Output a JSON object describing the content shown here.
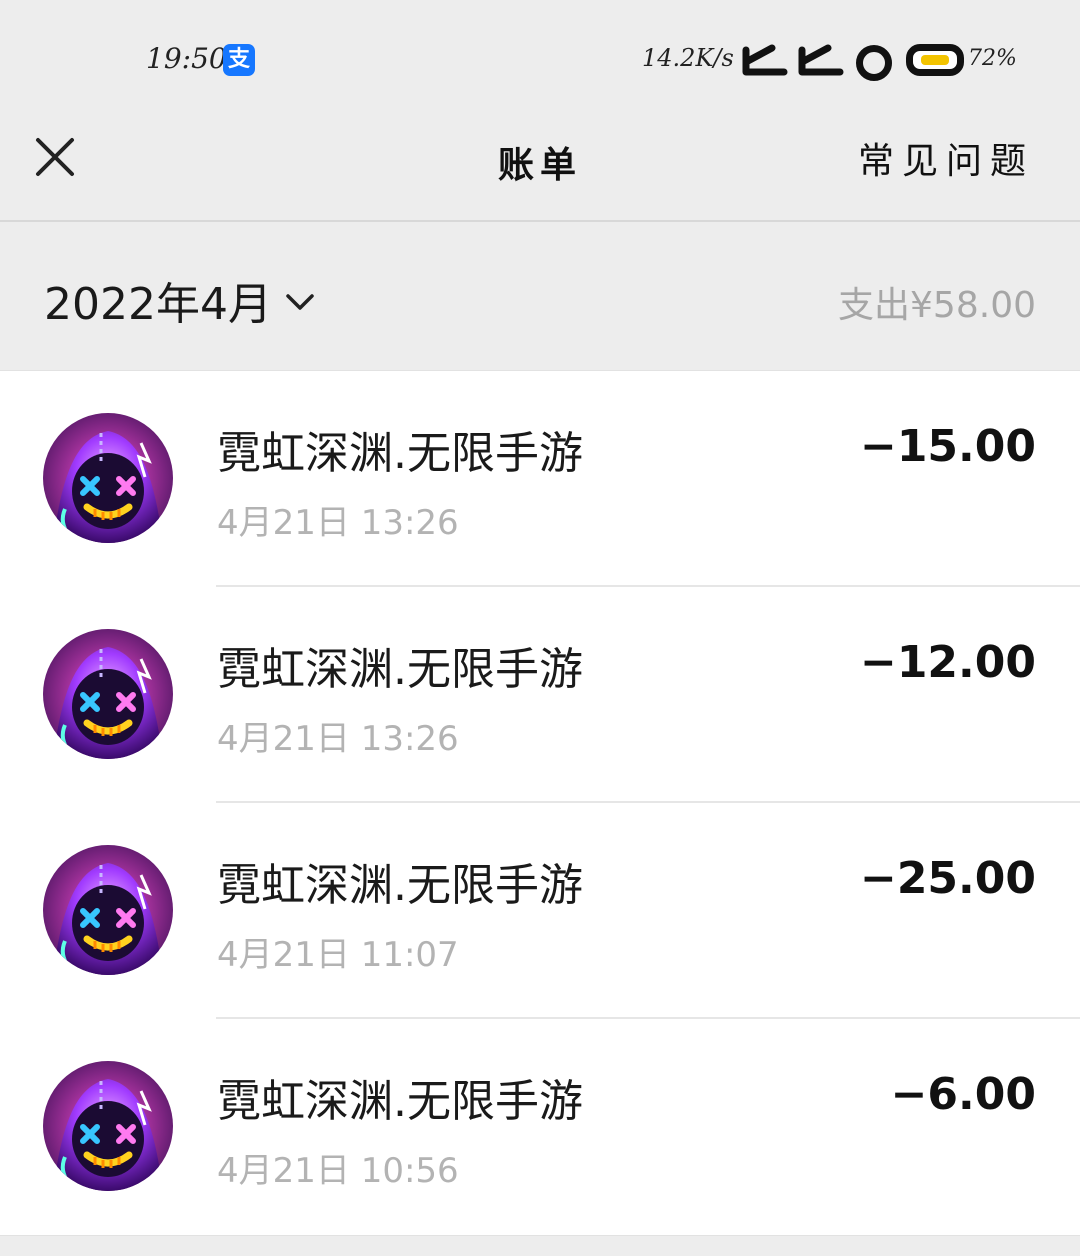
{
  "status_bar": {
    "time": "19:50",
    "app_badge": "支",
    "net_speed": "14.2K/s",
    "battery": "72%"
  },
  "nav": {
    "title": "账单",
    "faq": "常见问题"
  },
  "summary": {
    "month": "2022年4月",
    "expense": "支出¥58.00"
  },
  "transactions": [
    {
      "title": "霓虹深渊.无限手游",
      "time": "4月21日 13:26",
      "amount": "−15.00"
    },
    {
      "title": "霓虹深渊.无限手游",
      "time": "4月21日 13:26",
      "amount": "−12.00"
    },
    {
      "title": "霓虹深渊.无限手游",
      "time": "4月21日 11:07",
      "amount": "−25.00"
    },
    {
      "title": "霓虹深渊.无限手游",
      "time": "4月21日 10:56",
      "amount": "−6.00"
    }
  ],
  "colors": {
    "background": "#ededed",
    "list_background": "#ffffff",
    "muted_text": "#a6a6a6",
    "alipay_blue": "#1677ff",
    "battery_yellow": "#f3c400"
  }
}
